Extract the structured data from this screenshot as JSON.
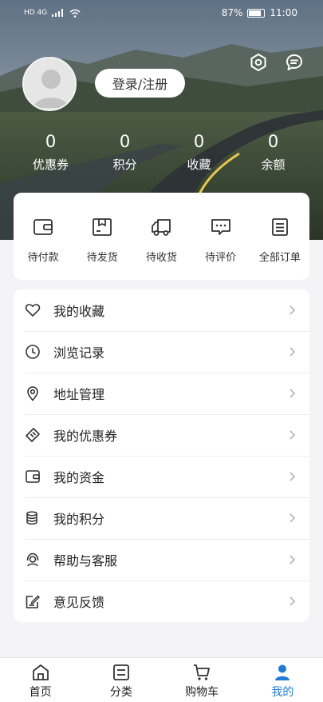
{
  "status_bar": {
    "network": "HD 4G",
    "battery": "87%",
    "time": "11:00"
  },
  "header": {
    "login_label": "登录/注册",
    "settings_icon": "settings-icon",
    "message_icon": "message-icon"
  },
  "stats": [
    {
      "value": "0",
      "label": "优惠券"
    },
    {
      "value": "0",
      "label": "积分"
    },
    {
      "value": "0",
      "label": "收藏"
    },
    {
      "value": "0",
      "label": "余额"
    }
  ],
  "orders": [
    {
      "label": "待付款",
      "icon": "wallet-icon"
    },
    {
      "label": "待发货",
      "icon": "box-icon"
    },
    {
      "label": "待收货",
      "icon": "truck-icon"
    },
    {
      "label": "待评价",
      "icon": "comment-icon"
    },
    {
      "label": "全部订单",
      "icon": "order-list-icon"
    }
  ],
  "menu": [
    {
      "label": "我的收藏",
      "icon": "heart-icon"
    },
    {
      "label": "浏览记录",
      "icon": "clock-icon"
    },
    {
      "label": "地址管理",
      "icon": "location-icon"
    },
    {
      "label": "我的优惠券",
      "icon": "coupon-icon"
    },
    {
      "label": "我的资金",
      "icon": "wallet-icon"
    },
    {
      "label": "我的积分",
      "icon": "coins-icon"
    },
    {
      "label": "帮助与客服",
      "icon": "support-icon"
    },
    {
      "label": "意见反馈",
      "icon": "feedback-icon"
    }
  ],
  "tabbar": [
    {
      "label": "首页",
      "icon": "home-icon",
      "active": false
    },
    {
      "label": "分类",
      "icon": "category-icon",
      "active": false
    },
    {
      "label": "购物车",
      "icon": "cart-icon",
      "active": false
    },
    {
      "label": "我的",
      "icon": "user-icon",
      "active": true
    }
  ],
  "colors": {
    "accent": "#1e7bd8",
    "background": "#f4f4f6"
  }
}
